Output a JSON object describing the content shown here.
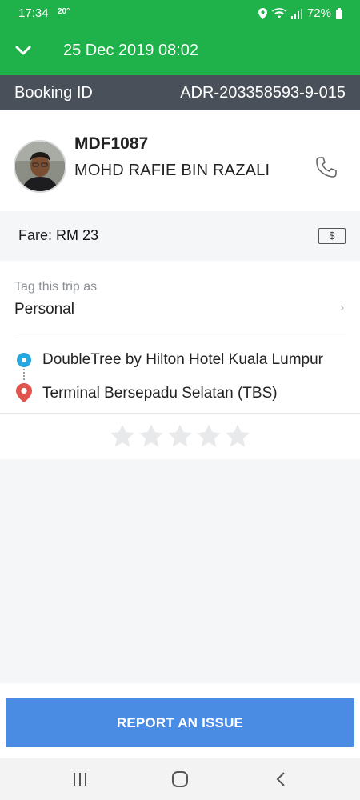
{
  "status_bar": {
    "time": "17:34",
    "temp": "20°",
    "battery": "72%"
  },
  "header": {
    "date": "25 Dec 2019 08:02"
  },
  "booking": {
    "label": "Booking ID",
    "id": "ADR-203358593-9-015"
  },
  "driver": {
    "plate": "MDF1087",
    "name": "MOHD RAFIE BIN RAZALI"
  },
  "fare": {
    "label": "Fare:",
    "amount": "RM 23",
    "payment_icon": "$"
  },
  "trip": {
    "tag_label": "Tag this trip as",
    "tag_value": "Personal",
    "tag_arrow": "›",
    "pickup": "DoubleTree by Hilton Hotel Kuala Lumpur",
    "dropoff": "Terminal Bersepadu Selatan (TBS)",
    "rating": 0,
    "max_rating": 5
  },
  "actions": {
    "report": "REPORT AN ISSUE"
  },
  "colors": {
    "brand_green": "#1fb24a",
    "booking_bar": "#4a5059",
    "report_button": "#4a8be3",
    "pickup_dot": "#27a8e0",
    "dropoff_pin": "#e0544e"
  }
}
